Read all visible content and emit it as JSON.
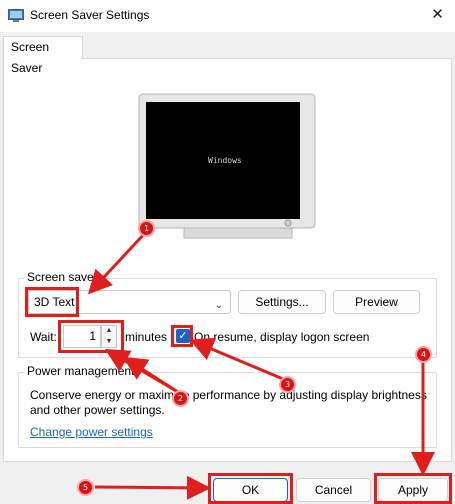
{
  "window": {
    "title": "Screen Saver Settings",
    "close_glyph": "✕"
  },
  "tab": {
    "label": "Screen Saver"
  },
  "screensaver": {
    "group_label": "Screen saver",
    "selected": "3D Text",
    "settings_label": "Settings...",
    "preview_label": "Preview",
    "wait_label": "Wait:",
    "wait_value": "1",
    "minutes_label": "minutes",
    "on_resume_checked": true,
    "on_resume_label": "On resume, display logon screen"
  },
  "power": {
    "group_label": "Power management",
    "description": "Conserve energy or maximize performance by adjusting display brightness and other power settings.",
    "link_label": "Change power settings"
  },
  "footer": {
    "ok_label": "OK",
    "cancel_label": "Cancel",
    "apply_label": "Apply"
  },
  "annotations": {
    "color": "#e01e1e",
    "badges": [
      "1",
      "2",
      "3",
      "4",
      "5"
    ]
  }
}
